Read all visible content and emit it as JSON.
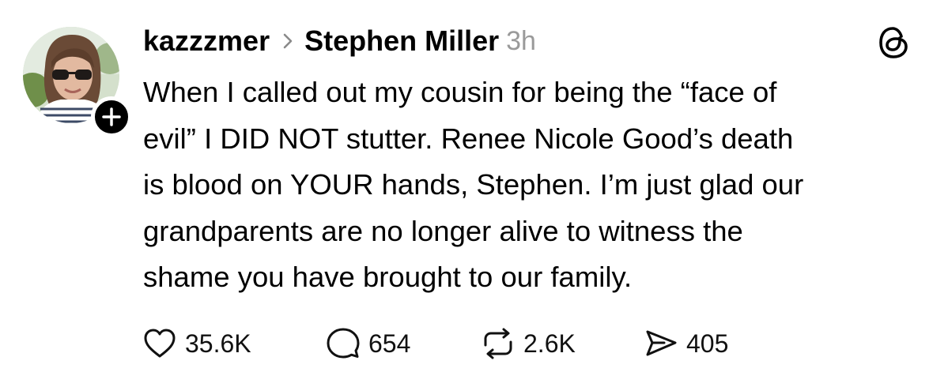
{
  "post": {
    "username": "kazzzmer",
    "reply_to": "Stephen Miller",
    "time": "3h",
    "text_lines": [
      "When I called out my cousin for being the “face of",
      "evil”  I DID NOT stutter. Renee Nicole Good’s death",
      "is blood on YOUR hands, Stephen. I’m just glad our",
      "grandparents are no longer alive to witness the",
      "shame you have brought to our family."
    ],
    "stats": {
      "likes": "35.6K",
      "comments": "654",
      "reposts": "2.6K",
      "shares": "405"
    }
  },
  "icons": {
    "avatar": "profile-photo",
    "follow": "plus-icon",
    "chevron": "chevron-right-icon",
    "logo": "threads-logo-icon",
    "like": "heart-icon",
    "comment": "speech-bubble-icon",
    "repost": "repost-arrows-icon",
    "share": "send-icon"
  },
  "colors": {
    "text": "#000000",
    "muted": "#9a9a9a",
    "background": "#ffffff"
  }
}
